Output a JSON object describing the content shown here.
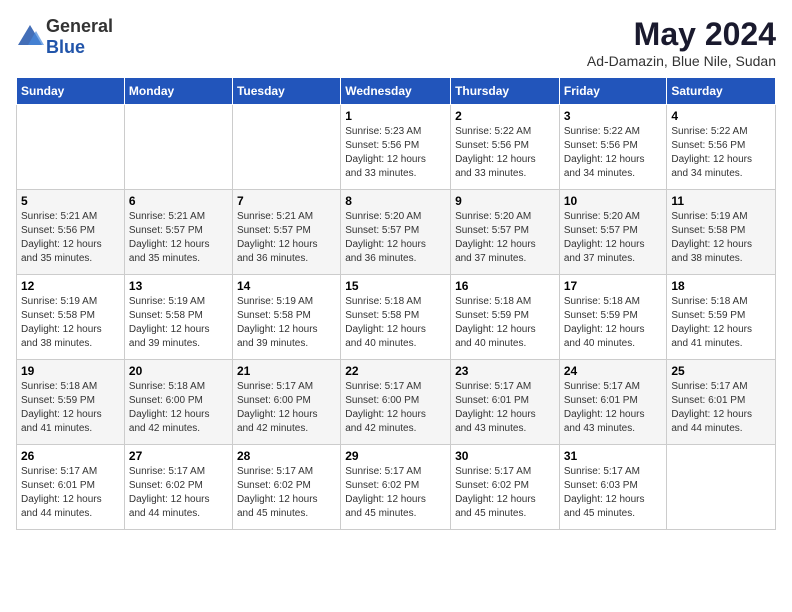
{
  "header": {
    "logo_general": "General",
    "logo_blue": "Blue",
    "title": "May 2024",
    "subtitle": "Ad-Damazin, Blue Nile, Sudan"
  },
  "columns": [
    "Sunday",
    "Monday",
    "Tuesday",
    "Wednesday",
    "Thursday",
    "Friday",
    "Saturday"
  ],
  "weeks": [
    {
      "days": [
        {
          "number": "",
          "info": ""
        },
        {
          "number": "",
          "info": ""
        },
        {
          "number": "",
          "info": ""
        },
        {
          "number": "1",
          "info": "Sunrise: 5:23 AM\nSunset: 5:56 PM\nDaylight: 12 hours\nand 33 minutes."
        },
        {
          "number": "2",
          "info": "Sunrise: 5:22 AM\nSunset: 5:56 PM\nDaylight: 12 hours\nand 33 minutes."
        },
        {
          "number": "3",
          "info": "Sunrise: 5:22 AM\nSunset: 5:56 PM\nDaylight: 12 hours\nand 34 minutes."
        },
        {
          "number": "4",
          "info": "Sunrise: 5:22 AM\nSunset: 5:56 PM\nDaylight: 12 hours\nand 34 minutes."
        }
      ]
    },
    {
      "days": [
        {
          "number": "5",
          "info": "Sunrise: 5:21 AM\nSunset: 5:56 PM\nDaylight: 12 hours\nand 35 minutes."
        },
        {
          "number": "6",
          "info": "Sunrise: 5:21 AM\nSunset: 5:57 PM\nDaylight: 12 hours\nand 35 minutes."
        },
        {
          "number": "7",
          "info": "Sunrise: 5:21 AM\nSunset: 5:57 PM\nDaylight: 12 hours\nand 36 minutes."
        },
        {
          "number": "8",
          "info": "Sunrise: 5:20 AM\nSunset: 5:57 PM\nDaylight: 12 hours\nand 36 minutes."
        },
        {
          "number": "9",
          "info": "Sunrise: 5:20 AM\nSunset: 5:57 PM\nDaylight: 12 hours\nand 37 minutes."
        },
        {
          "number": "10",
          "info": "Sunrise: 5:20 AM\nSunset: 5:57 PM\nDaylight: 12 hours\nand 37 minutes."
        },
        {
          "number": "11",
          "info": "Sunrise: 5:19 AM\nSunset: 5:58 PM\nDaylight: 12 hours\nand 38 minutes."
        }
      ]
    },
    {
      "days": [
        {
          "number": "12",
          "info": "Sunrise: 5:19 AM\nSunset: 5:58 PM\nDaylight: 12 hours\nand 38 minutes."
        },
        {
          "number": "13",
          "info": "Sunrise: 5:19 AM\nSunset: 5:58 PM\nDaylight: 12 hours\nand 39 minutes."
        },
        {
          "number": "14",
          "info": "Sunrise: 5:19 AM\nSunset: 5:58 PM\nDaylight: 12 hours\nand 39 minutes."
        },
        {
          "number": "15",
          "info": "Sunrise: 5:18 AM\nSunset: 5:58 PM\nDaylight: 12 hours\nand 40 minutes."
        },
        {
          "number": "16",
          "info": "Sunrise: 5:18 AM\nSunset: 5:59 PM\nDaylight: 12 hours\nand 40 minutes."
        },
        {
          "number": "17",
          "info": "Sunrise: 5:18 AM\nSunset: 5:59 PM\nDaylight: 12 hours\nand 40 minutes."
        },
        {
          "number": "18",
          "info": "Sunrise: 5:18 AM\nSunset: 5:59 PM\nDaylight: 12 hours\nand 41 minutes."
        }
      ]
    },
    {
      "days": [
        {
          "number": "19",
          "info": "Sunrise: 5:18 AM\nSunset: 5:59 PM\nDaylight: 12 hours\nand 41 minutes."
        },
        {
          "number": "20",
          "info": "Sunrise: 5:18 AM\nSunset: 6:00 PM\nDaylight: 12 hours\nand 42 minutes."
        },
        {
          "number": "21",
          "info": "Sunrise: 5:17 AM\nSunset: 6:00 PM\nDaylight: 12 hours\nand 42 minutes."
        },
        {
          "number": "22",
          "info": "Sunrise: 5:17 AM\nSunset: 6:00 PM\nDaylight: 12 hours\nand 42 minutes."
        },
        {
          "number": "23",
          "info": "Sunrise: 5:17 AM\nSunset: 6:01 PM\nDaylight: 12 hours\nand 43 minutes."
        },
        {
          "number": "24",
          "info": "Sunrise: 5:17 AM\nSunset: 6:01 PM\nDaylight: 12 hours\nand 43 minutes."
        },
        {
          "number": "25",
          "info": "Sunrise: 5:17 AM\nSunset: 6:01 PM\nDaylight: 12 hours\nand 44 minutes."
        }
      ]
    },
    {
      "days": [
        {
          "number": "26",
          "info": "Sunrise: 5:17 AM\nSunset: 6:01 PM\nDaylight: 12 hours\nand 44 minutes."
        },
        {
          "number": "27",
          "info": "Sunrise: 5:17 AM\nSunset: 6:02 PM\nDaylight: 12 hours\nand 44 minutes."
        },
        {
          "number": "28",
          "info": "Sunrise: 5:17 AM\nSunset: 6:02 PM\nDaylight: 12 hours\nand 45 minutes."
        },
        {
          "number": "29",
          "info": "Sunrise: 5:17 AM\nSunset: 6:02 PM\nDaylight: 12 hours\nand 45 minutes."
        },
        {
          "number": "30",
          "info": "Sunrise: 5:17 AM\nSunset: 6:02 PM\nDaylight: 12 hours\nand 45 minutes."
        },
        {
          "number": "31",
          "info": "Sunrise: 5:17 AM\nSunset: 6:03 PM\nDaylight: 12 hours\nand 45 minutes."
        },
        {
          "number": "",
          "info": ""
        }
      ]
    }
  ]
}
